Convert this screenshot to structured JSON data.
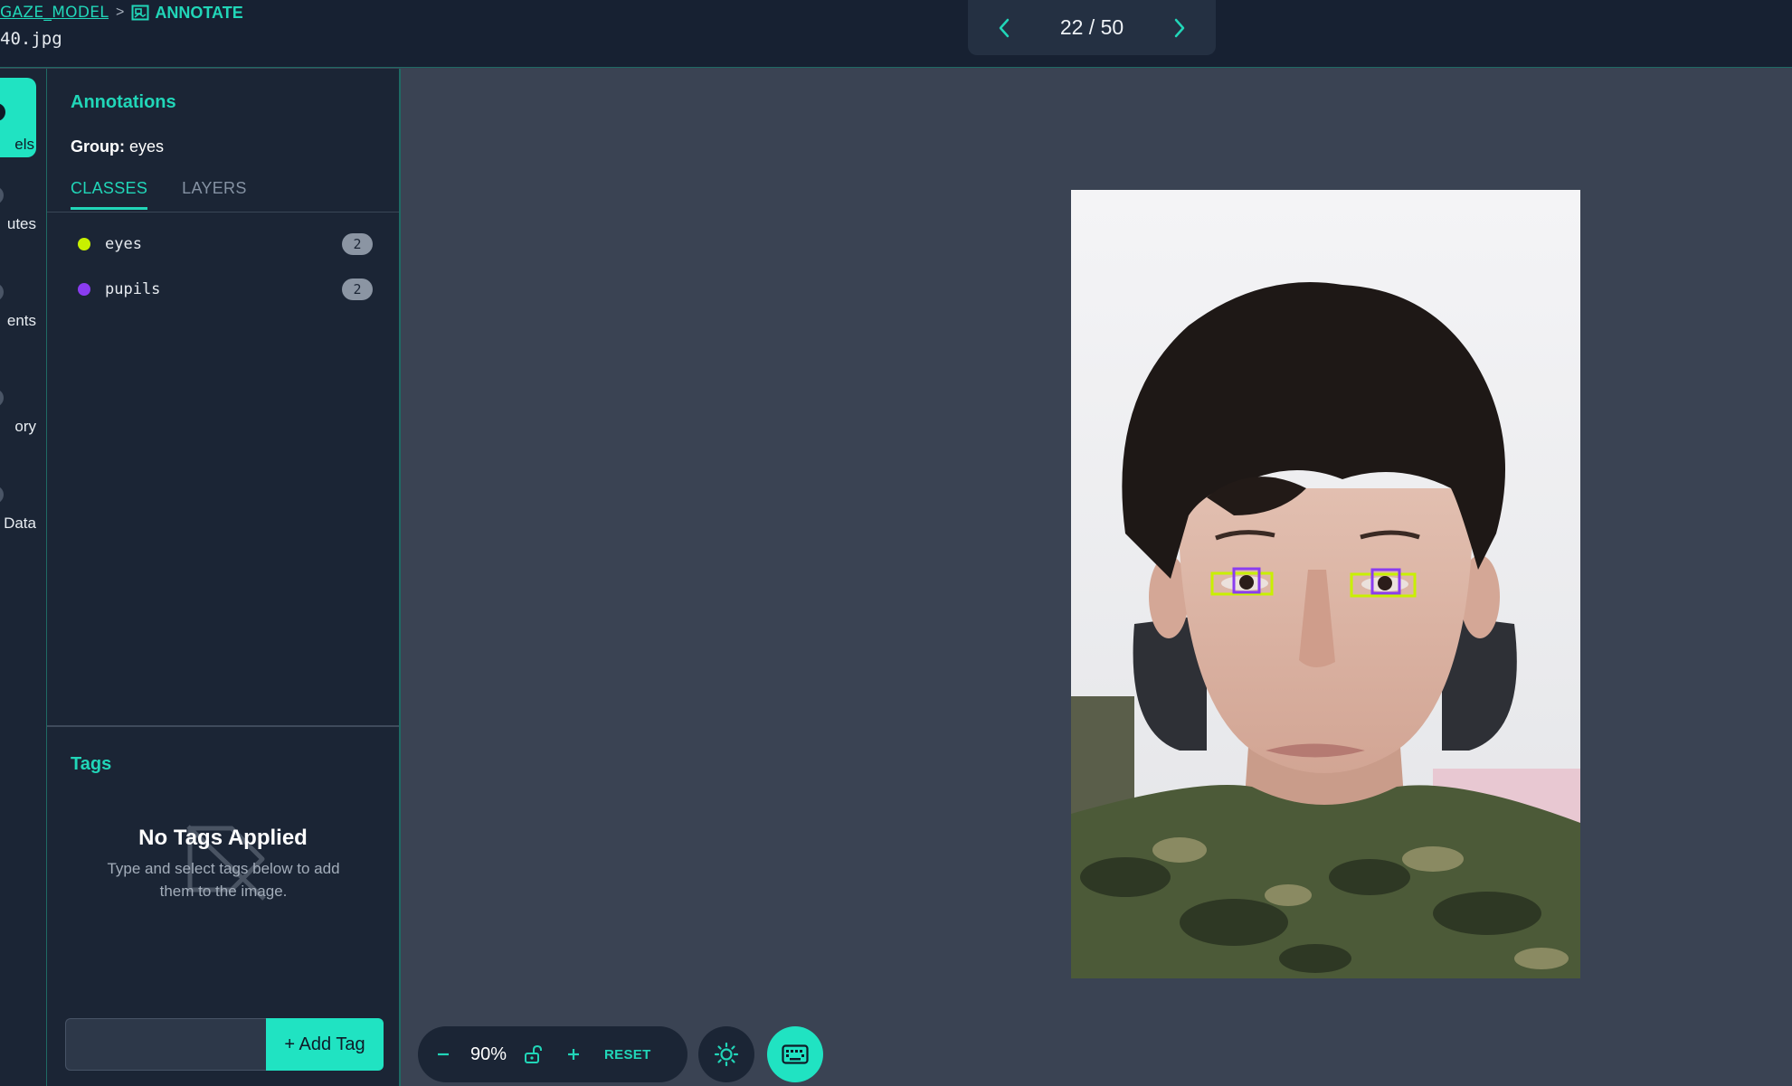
{
  "header": {
    "breadcrumb_project": "GAZE_MODEL",
    "breadcrumb_separator": ">",
    "breadcrumb_current": "ANNOTATE",
    "filename": "40.jpg",
    "pager_label": "22 / 50"
  },
  "rail": {
    "items": [
      {
        "label": "els",
        "active": true
      },
      {
        "label": "utes"
      },
      {
        "label": "ents"
      },
      {
        "label": "ory"
      },
      {
        "label": "Data"
      }
    ]
  },
  "annotations": {
    "title": "Annotations",
    "group_prefix": "Group:",
    "group_name": "eyes",
    "tabs": [
      "CLASSES",
      "LAYERS"
    ],
    "classes": [
      {
        "name": "eyes",
        "count": "2",
        "color": "#c8f000"
      },
      {
        "name": "pupils",
        "count": "2",
        "color": "#8a3cf0"
      }
    ]
  },
  "tags": {
    "title": "Tags",
    "empty_title": "No Tags Applied",
    "empty_subtitle": "Type and select tags below to add them to the image.",
    "input_value": "",
    "add_button": "+ Add Tag"
  },
  "toolbar": {
    "zoom": "90%",
    "reset": "RESET"
  },
  "colors": {
    "accent": "#20e3c2",
    "eyes_box": "#c8f000",
    "pupils_box": "#8a3cf0"
  }
}
